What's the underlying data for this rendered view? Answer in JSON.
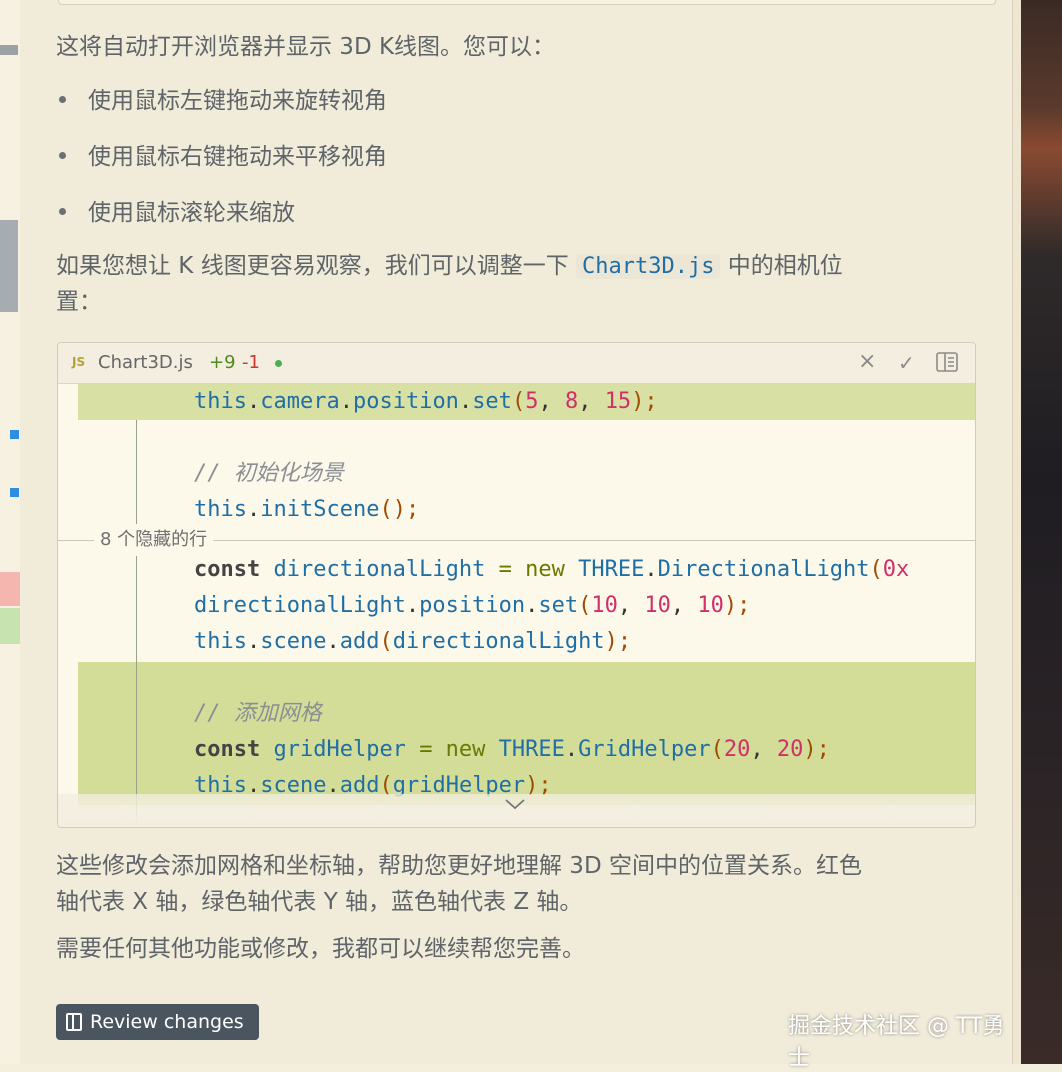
{
  "message": {
    "intro": "这将自动打开浏览器并显示 3D K线图。您可以：",
    "bullets": [
      "使用鼠标左键拖动来旋转视角",
      "使用鼠标右键拖动来平移视角",
      "使用鼠标滚轮来缩放"
    ],
    "camera_hint_before": "如果您想让 K 线图更容易观察，我们可以调整一下 ",
    "camera_hint_code": "Chart3D.js",
    "camera_hint_after": " 中的相机位",
    "camera_hint_wrap": "置：",
    "summary_line1": "这些修改会添加网格和坐标轴，帮助您更好地理解 3D 空间中的位置关系。红色",
    "summary_line2": "轴代表 X 轴，绿色轴代表 Y 轴，蓝色轴代表 Z 轴。",
    "closing": "需要任何其他功能或修改，我都可以继续帮您完善。"
  },
  "code_card": {
    "language_badge": "JS",
    "filename": "Chart3D.js",
    "added": "+9",
    "removed": "-1",
    "hidden_lines_label": "8 个隐藏的行",
    "close_icon": "×",
    "accept_icon": "✓",
    "panel_icon": "panel-icon",
    "lines": {
      "l1": {
        "a": "this",
        "b": ".",
        "c": "camera",
        "d": ".",
        "e": "position",
        "f": ".",
        "g": "set",
        "h": "(",
        "i": "5",
        "j": ", ",
        "k": "8",
        "l": ", ",
        "m": "15",
        "n": ");"
      },
      "l2": {
        "comment": "// 初始化场景"
      },
      "l3": {
        "a": "this",
        "b": ".",
        "c": "initScene",
        "d": "();"
      },
      "l4": {
        "a": "const",
        "b": " directionalLight ",
        "c": "=",
        "d": " new ",
        "e": "THREE",
        "f": ".",
        "g": "DirectionalLight",
        "h": "(",
        "i": "0x"
      },
      "l5": {
        "a": "directionalLight",
        "b": ".",
        "c": "position",
        "d": ".",
        "e": "set",
        "f": "(",
        "g": "10",
        "h": ", ",
        "i": "10",
        "j": ", ",
        "k": "10",
        "l": ");"
      },
      "l6": {
        "a": "this",
        "b": ".",
        "c": "scene",
        "d": ".",
        "e": "add",
        "f": "(",
        "g": "directionalLight",
        "h": ");"
      },
      "l7": {
        "comment": "// 添加网格"
      },
      "l8": {
        "a": "const",
        "b": " gridHelper ",
        "c": "=",
        "d": " new ",
        "e": "THREE",
        "f": ".",
        "g": "GridHelper",
        "h": "(",
        "i": "20",
        "j": ", ",
        "k": "20",
        "l": ");"
      },
      "l9": {
        "a": "this",
        "b": ".",
        "c": "scene",
        "d": ".",
        "e": "add",
        "f": "(",
        "g": "gridHelper",
        "h": ");"
      }
    },
    "expand_icon": "⌄"
  },
  "review_button": {
    "label": "Review changes"
  },
  "watermark": "掘金技术社区 @ TT勇士",
  "colors": {
    "added": "#4f8a1c",
    "removed": "#c8372d",
    "highlight": "#d3dd98",
    "button": "#4a5560"
  }
}
